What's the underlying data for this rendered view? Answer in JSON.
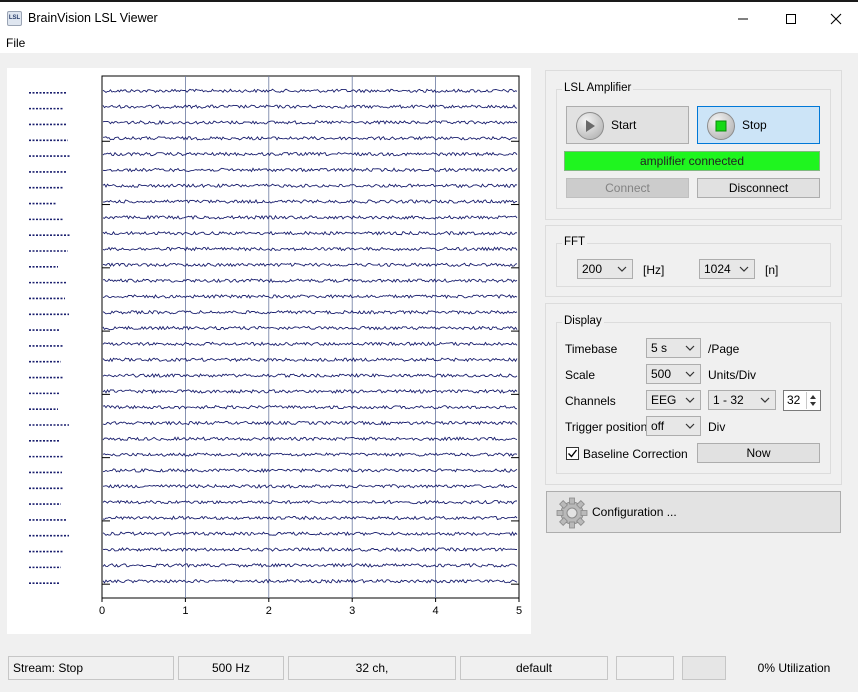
{
  "window": {
    "title": "BrainVision LSL Viewer",
    "icon_text": "LSL"
  },
  "menu": {
    "file": "File"
  },
  "plot": {
    "x_ticks": [
      "0",
      "1",
      "2",
      "3",
      "4",
      "5"
    ],
    "channel_count": 32,
    "trace_color": "#1a1f6e"
  },
  "amplifier": {
    "title": "LSL Amplifier",
    "start_label": "Start",
    "stop_label": "Stop",
    "status_text": "amplifier connected",
    "status_color": "#1ff51f",
    "connect_label": "Connect",
    "disconnect_label": "Disconnect"
  },
  "fft": {
    "title": "FFT",
    "freq_value": "200",
    "freq_unit": "[Hz]",
    "size_value": "1024",
    "size_unit": "[n]"
  },
  "display": {
    "title": "Display",
    "timebase_label": "Timebase",
    "timebase_value": "5 s",
    "timebase_unit": "/Page",
    "scale_label": "Scale",
    "scale_value": "500",
    "scale_unit": "Units/Div",
    "channels_label": "Channels",
    "channels_type": "EEG",
    "channels_range": "1 - 32",
    "channels_count": "32",
    "trigger_label": "Trigger position",
    "trigger_value": "off",
    "trigger_unit": "Div",
    "baseline_label": "Baseline Correction",
    "baseline_checked": true,
    "now_label": "Now"
  },
  "configuration": {
    "label": "Configuration ..."
  },
  "statusbar": {
    "stream": "Stream: Stop",
    "rate": "500 Hz",
    "channels": "32 ch,",
    "mode": "default",
    "utilization": "0% Utilization"
  }
}
